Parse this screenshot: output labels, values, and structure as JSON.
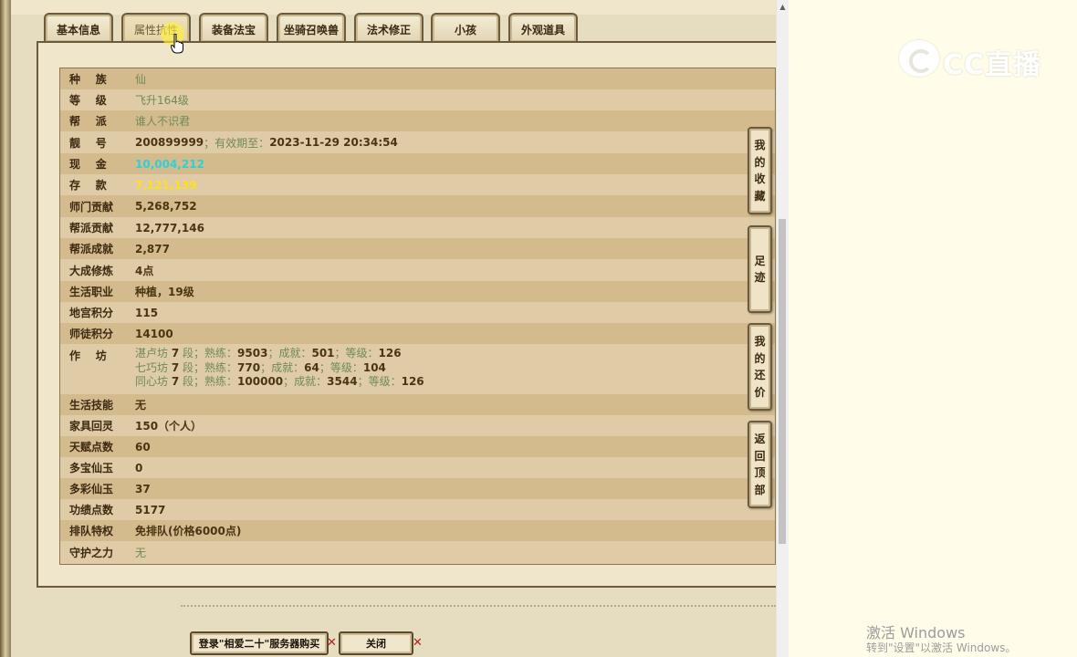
{
  "tabs": [
    {
      "label": "基本信息",
      "active": false
    },
    {
      "label": "属性抗性",
      "active": true
    },
    {
      "label": "装备法宝",
      "active": false
    },
    {
      "label": "坐骑召唤兽",
      "active": false
    },
    {
      "label": "法术修正",
      "active": false
    },
    {
      "label": "小孩",
      "active": false
    },
    {
      "label": "外观道具",
      "active": false
    }
  ],
  "info": {
    "race": {
      "label": "种    族",
      "value": "仙"
    },
    "level": {
      "label": "等    级",
      "value": "飞升164级"
    },
    "faction": {
      "label": "帮    派",
      "value": "谁人不识君"
    },
    "account": {
      "label": "靓    号",
      "number": "200899999",
      "sep": "；",
      "expiry_label": "有效期至：",
      "expiry": "2023-11-29 20:34:54"
    },
    "cash": {
      "label": "现    金",
      "value": "10,004,212"
    },
    "deposit": {
      "label": "存    款",
      "value": "7,121,139"
    },
    "sect_contribution": {
      "label": "师门贡献",
      "value": "5,268,752"
    },
    "faction_contribution": {
      "label": "帮派贡献",
      "value": "12,777,146"
    },
    "faction_achievement": {
      "label": "帮派成就",
      "value": "2,877"
    },
    "grand_cultivation": {
      "label": "大成修炼",
      "value": "4点"
    },
    "life_job": {
      "label": "生活职业",
      "value": "种植，19级"
    },
    "palace_points": {
      "label": "地宫积分",
      "value": "115"
    },
    "mentor_points": {
      "label": "师徒积分",
      "value": "14100"
    },
    "workshop": {
      "label": "作    坊",
      "lines": [
        {
          "name": "湛卢坊",
          "seg": "7",
          "seg_unit": "段；熟练：",
          "skill": "9503",
          "ach_label": "；成就：",
          "ach": "501",
          "lvl_label": "；等级：",
          "lvl": "126"
        },
        {
          "name": "七巧坊",
          "seg": "7",
          "seg_unit": "段；熟练：",
          "skill": "770",
          "ach_label": "；成就：",
          "ach": "64",
          "lvl_label": "；等级：",
          "lvl": "104"
        },
        {
          "name": "同心坊",
          "seg": "7",
          "seg_unit": "段；熟练：",
          "skill": "100000",
          "ach_label": "；成就：",
          "ach": "3544",
          "lvl_label": "；等级：",
          "lvl": "126"
        }
      ]
    },
    "life_skill": {
      "label": "生活技能",
      "value": "无"
    },
    "furniture_spirit": {
      "label": "家具回灵",
      "value": "150（个人）"
    },
    "talent_points": {
      "label": "天赋点数",
      "value": "60"
    },
    "duobao_jade": {
      "label": "多宝仙玉",
      "value": "0"
    },
    "duocai_jade": {
      "label": "多彩仙玉",
      "value": "37"
    },
    "merit_points": {
      "label": "功绩点数",
      "value": "5177"
    },
    "queue_privilege": {
      "label": "排队特权",
      "value": "免排队(价格6000点)"
    },
    "guardian_power": {
      "label": "守护之力",
      "value": "无"
    }
  },
  "side_buttons": {
    "favorites": "我的收藏",
    "footprints": "足迹",
    "my_bids": "我的还价",
    "back_to_top": "返回顶部"
  },
  "bottom": {
    "login_buy": "登录\"相爱二十\"服务器购买",
    "close": "关闭",
    "x_mark": "✕"
  },
  "watermark": {
    "logo_text": "CC直播",
    "activate_title": "激活 Windows",
    "activate_sub": "转到\"设置\"以激活 Windows。"
  },
  "colors": {
    "cash": "#2ed0d6",
    "deposit": "#ffe01e",
    "green_text": "#6f8a5a",
    "dark_text": "#4a3513"
  },
  "icons": [
    "cursor-hand-icon",
    "scroll-up-arrow-icon",
    "logo-icon"
  ]
}
